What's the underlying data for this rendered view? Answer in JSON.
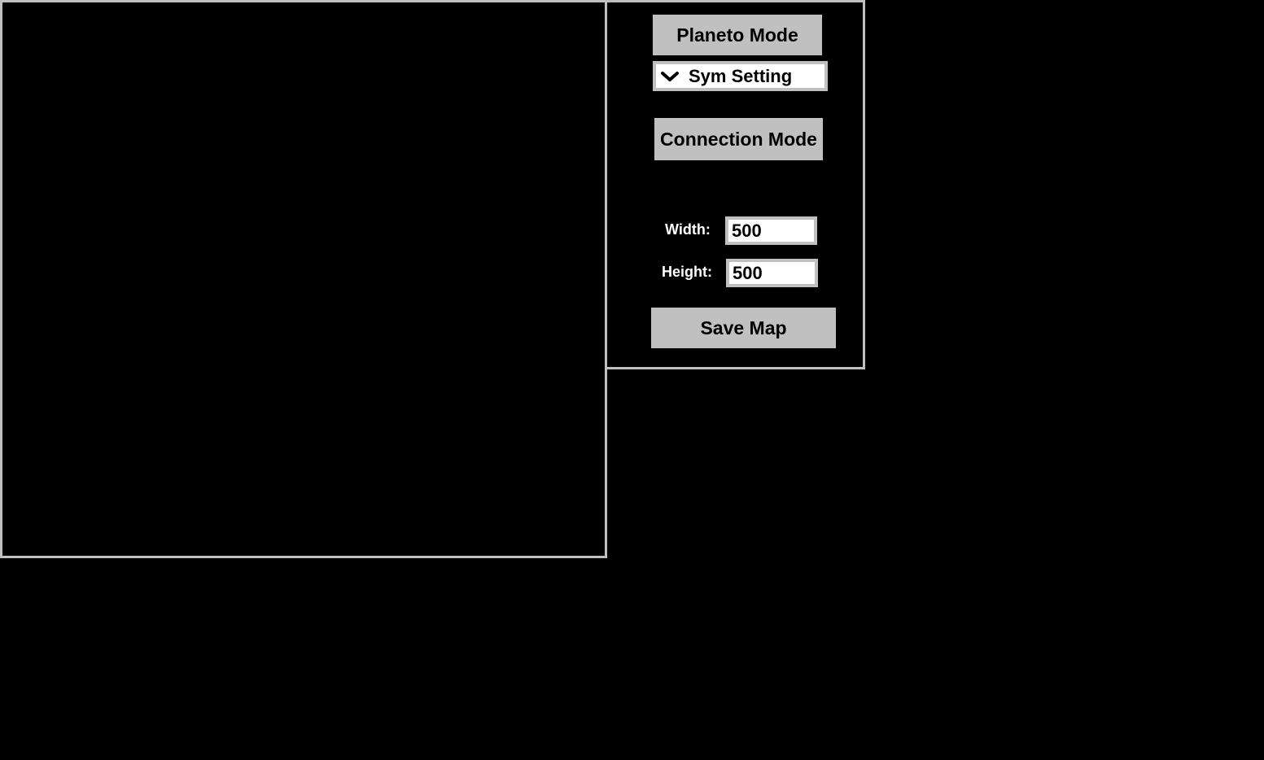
{
  "control_panel": {
    "planeto_mode_label": "Planeto Mode",
    "sym_setting": {
      "selected": "Sym Setting",
      "icon": "chevron-down-icon"
    },
    "connection_mode_label": "Connection Mode",
    "width_label": "Width:",
    "width_value": "500",
    "height_label": "Height:",
    "height_value": "500",
    "save_map_label": "Save Map"
  },
  "colors": {
    "background": "#000000",
    "border": "#c0c0c0",
    "button_bg": "#c0c0c0",
    "input_bg": "#ffffff",
    "label_text": "#ffffff"
  }
}
